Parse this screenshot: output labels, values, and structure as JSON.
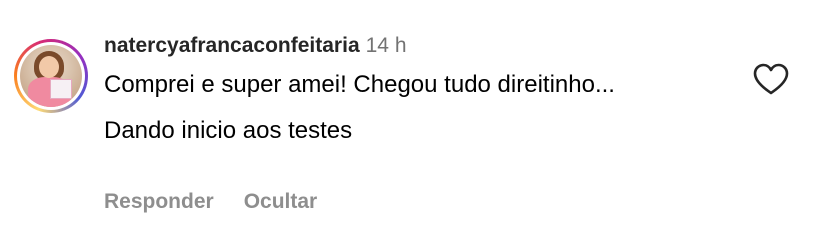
{
  "comment": {
    "username": "natercyafrancaconfeitaria",
    "time": "14 h",
    "text_line1": "Comprei e super amei!  Chegou tudo direitinho...",
    "text_line2": "Dando inicio aos testes",
    "actions": {
      "reply_label": "Responder",
      "hide_label": "Ocultar"
    },
    "like_icon": "heart-outline-icon",
    "story_ring_colors": [
      "#feda75",
      "#fa7e1e",
      "#d62976",
      "#962fbf",
      "#4f5bd5"
    ]
  }
}
